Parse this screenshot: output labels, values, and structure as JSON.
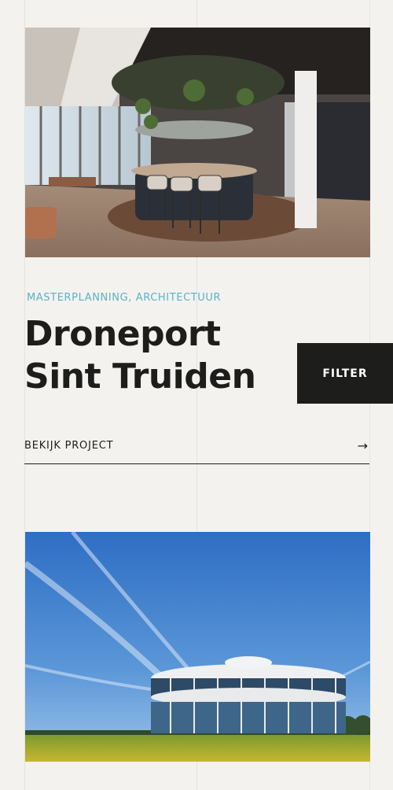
{
  "project": {
    "tags": "MASTERPLANNING, ARCHITECTUUR",
    "title_line1": "Droneport",
    "title_line2": "Sint Truiden",
    "link_label": "BEKIJK PROJECT",
    "link_arrow": "→"
  },
  "filter": {
    "label": "FILTER"
  },
  "colors": {
    "accent": "#58b3c3",
    "dark": "#1d1d1b",
    "background": "#f3f2ef"
  }
}
